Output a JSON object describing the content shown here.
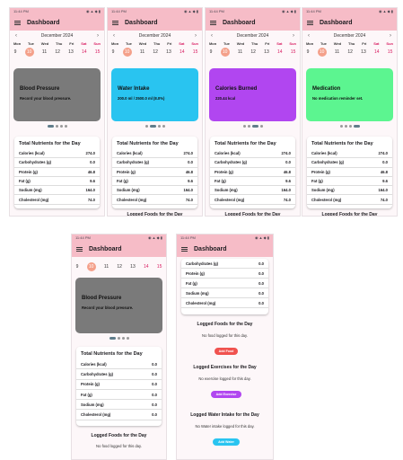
{
  "status_time": "11:44 PM",
  "status_icons": "◉ ▲ ◆ ▮",
  "app_title": "Dashboard",
  "month": "December 2024",
  "weekdays": [
    "Mon",
    "Tue",
    "Wed",
    "Thu",
    "Fri",
    "Sat",
    "Sun"
  ],
  "dates": [
    "9",
    "10",
    "11",
    "12",
    "13",
    "14",
    "15"
  ],
  "selected_date": "10",
  "banners": [
    {
      "title": "Blood Pressure",
      "subtitle": "Record your blood pressure.",
      "color": "#7a7a7a"
    },
    {
      "title": "Water Intake",
      "subtitle": "200.0 ml / 2500.0 ml (8.0%)",
      "color": "#29c4f0"
    },
    {
      "title": "Calories Burned",
      "subtitle": "220.44 kcal",
      "color": "#b146f0"
    },
    {
      "title": "Medication",
      "subtitle": "No medication reminder set.",
      "color": "#5cf590"
    }
  ],
  "nutrients_title": "Total Nutrients for the Day",
  "nutrients": [
    {
      "label": "Calories (kcal)",
      "value": "274.0"
    },
    {
      "label": "Carbohydrates (g)",
      "value": "0.0"
    },
    {
      "label": "Protein (g)",
      "value": "46.8"
    },
    {
      "label": "Fat (g)",
      "value": "9.6"
    },
    {
      "label": "Sodium (mg)",
      "value": "164.0"
    },
    {
      "label": "Cholesterol (mg)",
      "value": "74.0"
    }
  ],
  "nutrients_zero": [
    {
      "label": "Calories (kcal)",
      "value": "0.0"
    },
    {
      "label": "Carbohydrates (g)",
      "value": "0.0"
    },
    {
      "label": "Protein (g)",
      "value": "0.0"
    },
    {
      "label": "Fat (g)",
      "value": "0.0"
    },
    {
      "label": "Sodium (mg)",
      "value": "0.0"
    },
    {
      "label": "Cholesterol (mg)",
      "value": "0.0"
    }
  ],
  "logged_foods_title": "Logged Foods for the Day",
  "no_food": "No food logged for this day.",
  "add_food": "Add Food",
  "logged_ex_title": "Logged Exercises for the Day",
  "no_ex": "No exercise logged for this day.",
  "add_ex": "Add Exercise",
  "logged_water_title": "Logged Water Intake for the Day",
  "no_water": "No Water intake logged for this day.",
  "add_water": "Add Water",
  "colors": {
    "appbar": "#f6bcc7",
    "add_food": "#f0524f",
    "add_ex": "#b146f0",
    "add_water": "#29c4f0",
    "selected": "#f4a08a"
  }
}
